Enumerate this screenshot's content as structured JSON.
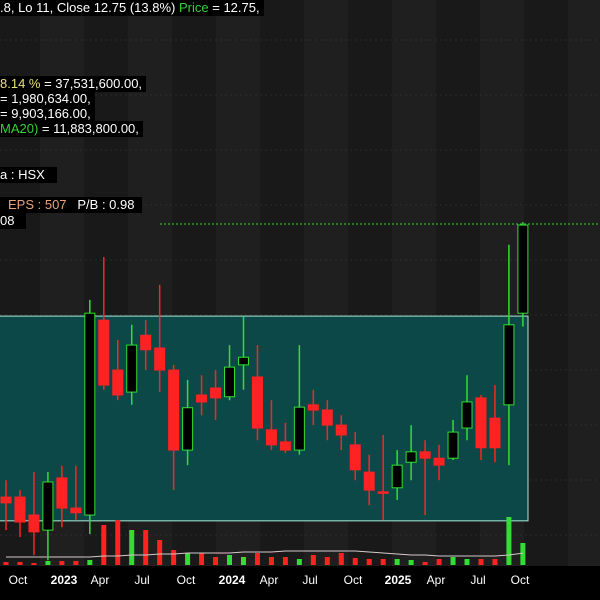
{
  "header": {
    "ohlc_text": ".8, Lo 11, Close 12.75 (13.8%)",
    "price_label": "Price",
    "price_value": " = 12.75,"
  },
  "volume_info": {
    "line1_label": "8.14 %",
    "line1_value": " = 37,531,600.00,",
    "line2": "= 1,980,634.00,",
    "line3": "= 9,903,166.00,",
    "line4_label": "MA20)",
    "line4_value": " = 11,883,800.00,"
  },
  "exchange": "a : HSX",
  "eps": "EPS : 507",
  "pb": "P/B : 0.98",
  "extra": "08",
  "colors": {
    "up": "#33dd33",
    "down": "#ff2222",
    "box_fill": "#0d4848",
    "box_border": "#a8e8d8",
    "price_line": "#3cd23c"
  },
  "chart_data": {
    "type": "candlestick",
    "x_tick_labels": [
      "Oct",
      "2023",
      "Apr",
      "Jul",
      "Oct",
      "2024",
      "Apr",
      "Jul",
      "Oct",
      "2025",
      "Apr",
      "Jul",
      "Oct"
    ],
    "last_close": 12.75,
    "box_range": [
      7.65,
      11.18
    ],
    "candles": [
      [
        8.06,
        7.96,
        8.35,
        7.49
      ],
      [
        8.06,
        7.63,
        8.18,
        7.37
      ],
      [
        7.75,
        7.46,
        8.49,
        7.06
      ],
      [
        7.49,
        8.32,
        8.49,
        6.97
      ],
      [
        8.39,
        7.87,
        8.6,
        7.54
      ],
      [
        7.87,
        7.79,
        8.6,
        7.66
      ],
      [
        7.75,
        11.23,
        11.46,
        7.42
      ],
      [
        11.11,
        9.99,
        12.2,
        9.91
      ],
      [
        10.25,
        9.82,
        10.77,
        9.73
      ],
      [
        9.87,
        10.68,
        11.03,
        9.65
      ],
      [
        10.85,
        10.6,
        11.11,
        10.25
      ],
      [
        10.63,
        10.25,
        11.72,
        9.87
      ],
      [
        10.25,
        8.87,
        10.34,
        8.18
      ],
      [
        8.87,
        9.6,
        10.08,
        8.61
      ],
      [
        9.82,
        9.7,
        10.16,
        9.47
      ],
      [
        9.94,
        9.77,
        10.25,
        9.39
      ],
      [
        9.79,
        10.3,
        10.68,
        9.73
      ],
      [
        10.34,
        10.47,
        11.18,
        9.91
      ],
      [
        10.13,
        9.25,
        10.68,
        9.04
      ],
      [
        9.22,
        8.96,
        9.73,
        8.87
      ],
      [
        9.01,
        8.87,
        9.34,
        8.82
      ],
      [
        8.87,
        9.61,
        10.68,
        8.79
      ],
      [
        9.65,
        9.56,
        9.91,
        9.3
      ],
      [
        9.56,
        9.3,
        9.73,
        9.04
      ],
      [
        9.3,
        9.13,
        9.47,
        8.87
      ],
      [
        8.96,
        8.53,
        9.18,
        8.35
      ],
      [
        8.49,
        8.18,
        8.79,
        7.92
      ],
      [
        8.15,
        8.13,
        9.13,
        7.66
      ],
      [
        8.22,
        8.61,
        8.87,
        8.01
      ],
      [
        8.66,
        8.84,
        9.3,
        8.35
      ],
      [
        8.84,
        8.73,
        9.04,
        7.75
      ],
      [
        8.73,
        8.61,
        8.96,
        8.35
      ],
      [
        8.73,
        9.18,
        9.39,
        8.7
      ],
      [
        9.25,
        9.7,
        10.16,
        9.04
      ],
      [
        9.77,
        8.91,
        9.82,
        8.7
      ],
      [
        9.42,
        8.91,
        9.99,
        8.66
      ],
      [
        9.65,
        11.03,
        12.41,
        8.61
      ],
      [
        11.23,
        12.75,
        12.8,
        11.0
      ]
    ],
    "volume_millions": [
      3,
      3,
      2,
      4,
      4,
      4,
      5,
      40,
      45,
      35,
      35,
      25,
      15,
      12,
      12,
      8,
      10,
      8,
      12,
      8,
      8,
      6,
      10,
      8,
      12,
      7,
      6,
      6,
      6,
      5,
      3,
      6,
      8,
      6,
      6,
      6,
      48,
      22
    ],
    "volume_ma20_millions": [
      8,
      8,
      8,
      8,
      8,
      8,
      8,
      9,
      9,
      10,
      10,
      11,
      11,
      12,
      12,
      12,
      12,
      13,
      13,
      13,
      14,
      14,
      14,
      14,
      14,
      14,
      13,
      12,
      11,
      10,
      10,
      9,
      9,
      9,
      9,
      9,
      10,
      11.9
    ]
  }
}
